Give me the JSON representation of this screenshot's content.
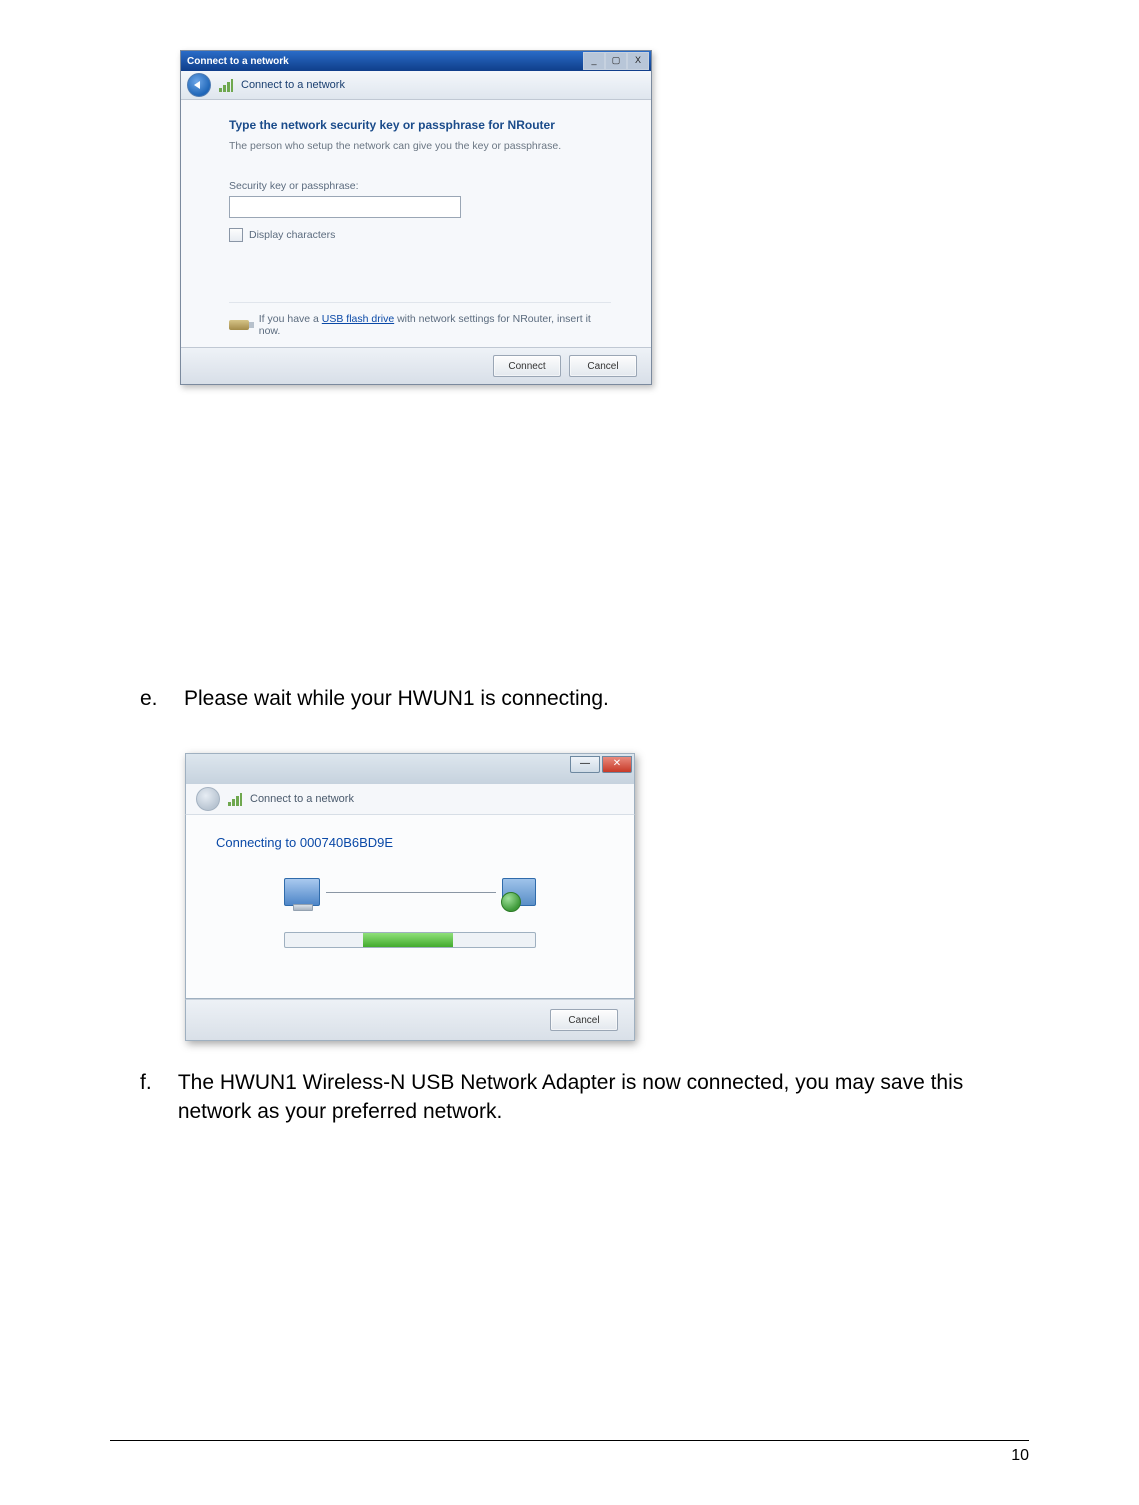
{
  "dialog1": {
    "window_title": "Connect to a network",
    "header_label": "Connect to a network",
    "heading": "Type the network security key or passphrase for NRouter",
    "subtext": "The person who setup the network can give you the key or passphrase.",
    "field_label": "Security key or passphrase:",
    "checkbox_label": "Display characters",
    "usb_text_prefix": "If you have a ",
    "usb_link": "USB flash drive",
    "usb_text_suffix": " with network settings for NRouter, insert it now.",
    "connect_btn": "Connect",
    "cancel_btn": "Cancel"
  },
  "step_e": {
    "letter": "e.",
    "text": "Please wait while your HWUN1 is connecting."
  },
  "dialog2": {
    "header_label": "Connect to a network",
    "status": "Connecting to 000740B6BD9E",
    "cancel_btn": "Cancel"
  },
  "step_f": {
    "letter": "f.",
    "text": "The HWUN1 Wireless-N USB Network Adapter is now connected,  you may save this network as your preferred network."
  },
  "page_number": "10"
}
